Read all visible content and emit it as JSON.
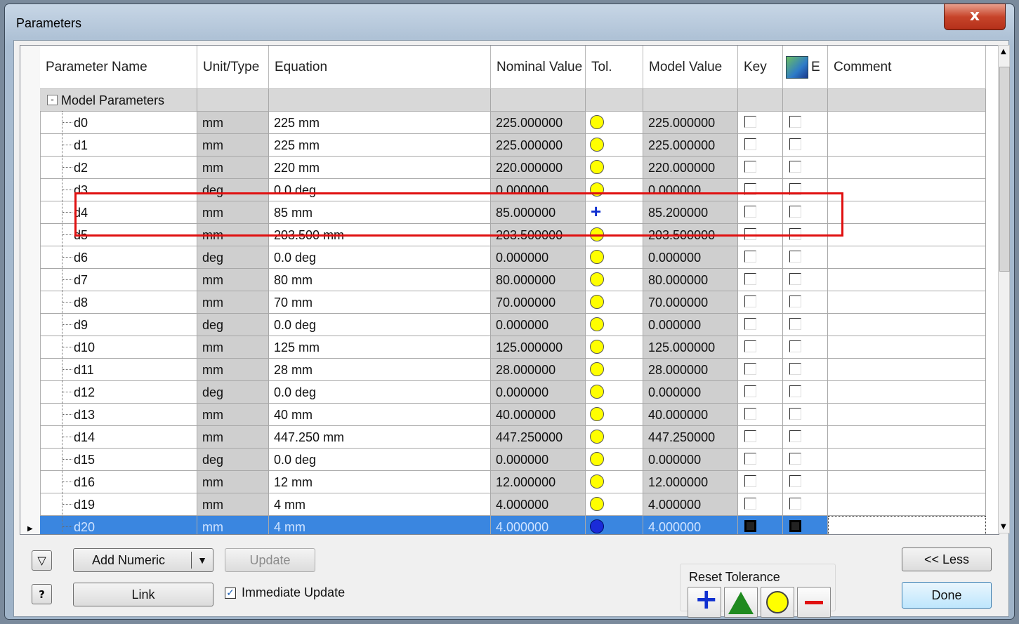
{
  "window": {
    "title": "Parameters",
    "close_symbol": "x"
  },
  "columns": {
    "name": "Parameter Name",
    "unit": "Unit/Type",
    "equation": "Equation",
    "nominal": "Nominal Value",
    "tol": "Tol.",
    "model": "Model Value",
    "key": "Key",
    "export": "E",
    "comment": "Comment"
  },
  "group": {
    "label": "Model Parameters",
    "expander": "-"
  },
  "rows": [
    {
      "name": "d0",
      "unit": "mm",
      "equation": "225 mm",
      "nominal": "225.000000",
      "tol": "circle",
      "model": "225.000000"
    },
    {
      "name": "d1",
      "unit": "mm",
      "equation": "225 mm",
      "nominal": "225.000000",
      "tol": "circle",
      "model": "225.000000"
    },
    {
      "name": "d2",
      "unit": "mm",
      "equation": "220 mm",
      "nominal": "220.000000",
      "tol": "circle",
      "model": "220.000000"
    },
    {
      "name": "d3",
      "unit": "deg",
      "equation": "0.0 deg",
      "nominal": "0.000000",
      "tol": "circle",
      "model": "0.000000"
    },
    {
      "name": "d4",
      "unit": "mm",
      "equation": "85 mm",
      "nominal": "85.000000",
      "tol": "plus",
      "model": "85.200000"
    },
    {
      "name": "d5",
      "unit": "mm",
      "equation": "203.500 mm",
      "nominal": "203.500000",
      "tol": "circle",
      "model": "203.500000"
    },
    {
      "name": "d6",
      "unit": "deg",
      "equation": "0.0 deg",
      "nominal": "0.000000",
      "tol": "circle",
      "model": "0.000000"
    },
    {
      "name": "d7",
      "unit": "mm",
      "equation": "80 mm",
      "nominal": "80.000000",
      "tol": "circle",
      "model": "80.000000"
    },
    {
      "name": "d8",
      "unit": "mm",
      "equation": "70 mm",
      "nominal": "70.000000",
      "tol": "circle",
      "model": "70.000000"
    },
    {
      "name": "d9",
      "unit": "deg",
      "equation": "0.0 deg",
      "nominal": "0.000000",
      "tol": "circle",
      "model": "0.000000"
    },
    {
      "name": "d10",
      "unit": "mm",
      "equation": "125 mm",
      "nominal": "125.000000",
      "tol": "circle",
      "model": "125.000000"
    },
    {
      "name": "d11",
      "unit": "mm",
      "equation": "28 mm",
      "nominal": "28.000000",
      "tol": "circle",
      "model": "28.000000"
    },
    {
      "name": "d12",
      "unit": "deg",
      "equation": "0.0 deg",
      "nominal": "0.000000",
      "tol": "circle",
      "model": "0.000000"
    },
    {
      "name": "d13",
      "unit": "mm",
      "equation": "40 mm",
      "nominal": "40.000000",
      "tol": "circle",
      "model": "40.000000"
    },
    {
      "name": "d14",
      "unit": "mm",
      "equation": "447.250 mm",
      "nominal": "447.250000",
      "tol": "circle",
      "model": "447.250000"
    },
    {
      "name": "d15",
      "unit": "deg",
      "equation": "0.0 deg",
      "nominal": "0.000000",
      "tol": "circle",
      "model": "0.000000"
    },
    {
      "name": "d16",
      "unit": "mm",
      "equation": "12 mm",
      "nominal": "12.000000",
      "tol": "circle",
      "model": "12.000000"
    },
    {
      "name": "d19",
      "unit": "mm",
      "equation": "4 mm",
      "nominal": "4.000000",
      "tol": "circle",
      "model": "4.000000"
    },
    {
      "name": "d20",
      "unit": "mm",
      "equation": "4 mm",
      "nominal": "4.000000",
      "tol": "circle",
      "model": "4.000000",
      "selected": true
    }
  ],
  "buttons": {
    "add_numeric": "Add Numeric",
    "update": "Update",
    "link": "Link",
    "less": "<< Less",
    "done": "Done",
    "help": "?"
  },
  "immediate_update": {
    "label": "Immediate Update",
    "checked": true
  },
  "reset_tolerance": {
    "label": "Reset Tolerance",
    "plus_symbol": "+",
    "minus_symbol": "−"
  },
  "colors": {
    "tolerance_circle": "#ffff00",
    "selected_row": "#3a86e0",
    "highlight_box": "#e01010",
    "plus": "#1030d0"
  }
}
